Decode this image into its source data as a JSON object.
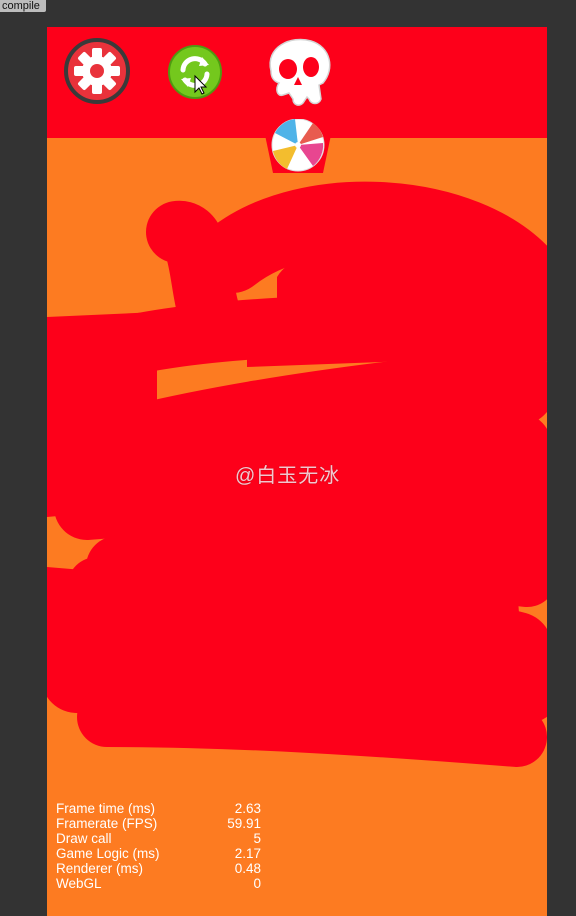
{
  "editor": {
    "compile_tab_label": "compile"
  },
  "game": {
    "background_color": "#fd7b21",
    "topbar_color": "#fd001a",
    "ink_color": "#fd001a",
    "buttons": [
      {
        "name": "settings",
        "icon": "gear-icon"
      },
      {
        "name": "restart",
        "icon": "refresh-icon"
      },
      {
        "name": "skull",
        "icon": "skull-icon"
      }
    ],
    "ball_icon": "beach-ball-icon",
    "watermark": "@白玉无冰"
  },
  "stats": [
    {
      "label": "Frame time (ms)",
      "value": "2.63"
    },
    {
      "label": "Framerate (FPS)",
      "value": "59.91"
    },
    {
      "label": "Draw call",
      "value": "5"
    },
    {
      "label": "Game Logic (ms)",
      "value": "2.17"
    },
    {
      "label": "Renderer (ms)",
      "value": "0.48"
    },
    {
      "label": "WebGL",
      "value": "0"
    }
  ]
}
